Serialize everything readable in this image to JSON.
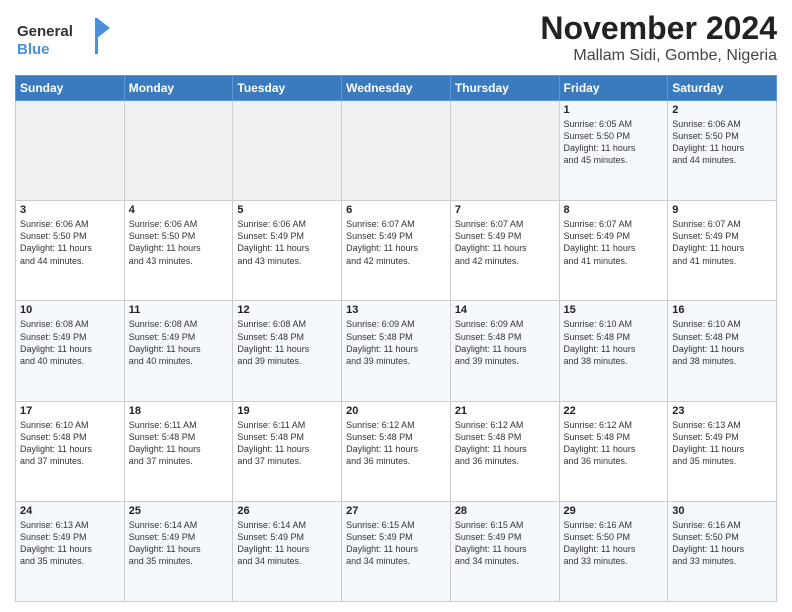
{
  "logo": {
    "line1": "General",
    "line2": "Blue"
  },
  "title": "November 2024",
  "subtitle": "Mallam Sidi, Gombe, Nigeria",
  "days_header": [
    "Sunday",
    "Monday",
    "Tuesday",
    "Wednesday",
    "Thursday",
    "Friday",
    "Saturday"
  ],
  "weeks": [
    [
      {
        "day": "",
        "info": ""
      },
      {
        "day": "",
        "info": ""
      },
      {
        "day": "",
        "info": ""
      },
      {
        "day": "",
        "info": ""
      },
      {
        "day": "",
        "info": ""
      },
      {
        "day": "1",
        "info": "Sunrise: 6:05 AM\nSunset: 5:50 PM\nDaylight: 11 hours\nand 45 minutes."
      },
      {
        "day": "2",
        "info": "Sunrise: 6:06 AM\nSunset: 5:50 PM\nDaylight: 11 hours\nand 44 minutes."
      }
    ],
    [
      {
        "day": "3",
        "info": "Sunrise: 6:06 AM\nSunset: 5:50 PM\nDaylight: 11 hours\nand 44 minutes."
      },
      {
        "day": "4",
        "info": "Sunrise: 6:06 AM\nSunset: 5:50 PM\nDaylight: 11 hours\nand 43 minutes."
      },
      {
        "day": "5",
        "info": "Sunrise: 6:06 AM\nSunset: 5:49 PM\nDaylight: 11 hours\nand 43 minutes."
      },
      {
        "day": "6",
        "info": "Sunrise: 6:07 AM\nSunset: 5:49 PM\nDaylight: 11 hours\nand 42 minutes."
      },
      {
        "day": "7",
        "info": "Sunrise: 6:07 AM\nSunset: 5:49 PM\nDaylight: 11 hours\nand 42 minutes."
      },
      {
        "day": "8",
        "info": "Sunrise: 6:07 AM\nSunset: 5:49 PM\nDaylight: 11 hours\nand 41 minutes."
      },
      {
        "day": "9",
        "info": "Sunrise: 6:07 AM\nSunset: 5:49 PM\nDaylight: 11 hours\nand 41 minutes."
      }
    ],
    [
      {
        "day": "10",
        "info": "Sunrise: 6:08 AM\nSunset: 5:49 PM\nDaylight: 11 hours\nand 40 minutes."
      },
      {
        "day": "11",
        "info": "Sunrise: 6:08 AM\nSunset: 5:49 PM\nDaylight: 11 hours\nand 40 minutes."
      },
      {
        "day": "12",
        "info": "Sunrise: 6:08 AM\nSunset: 5:48 PM\nDaylight: 11 hours\nand 39 minutes."
      },
      {
        "day": "13",
        "info": "Sunrise: 6:09 AM\nSunset: 5:48 PM\nDaylight: 11 hours\nand 39 minutes."
      },
      {
        "day": "14",
        "info": "Sunrise: 6:09 AM\nSunset: 5:48 PM\nDaylight: 11 hours\nand 39 minutes."
      },
      {
        "day": "15",
        "info": "Sunrise: 6:10 AM\nSunset: 5:48 PM\nDaylight: 11 hours\nand 38 minutes."
      },
      {
        "day": "16",
        "info": "Sunrise: 6:10 AM\nSunset: 5:48 PM\nDaylight: 11 hours\nand 38 minutes."
      }
    ],
    [
      {
        "day": "17",
        "info": "Sunrise: 6:10 AM\nSunset: 5:48 PM\nDaylight: 11 hours\nand 37 minutes."
      },
      {
        "day": "18",
        "info": "Sunrise: 6:11 AM\nSunset: 5:48 PM\nDaylight: 11 hours\nand 37 minutes."
      },
      {
        "day": "19",
        "info": "Sunrise: 6:11 AM\nSunset: 5:48 PM\nDaylight: 11 hours\nand 37 minutes."
      },
      {
        "day": "20",
        "info": "Sunrise: 6:12 AM\nSunset: 5:48 PM\nDaylight: 11 hours\nand 36 minutes."
      },
      {
        "day": "21",
        "info": "Sunrise: 6:12 AM\nSunset: 5:48 PM\nDaylight: 11 hours\nand 36 minutes."
      },
      {
        "day": "22",
        "info": "Sunrise: 6:12 AM\nSunset: 5:48 PM\nDaylight: 11 hours\nand 36 minutes."
      },
      {
        "day": "23",
        "info": "Sunrise: 6:13 AM\nSunset: 5:49 PM\nDaylight: 11 hours\nand 35 minutes."
      }
    ],
    [
      {
        "day": "24",
        "info": "Sunrise: 6:13 AM\nSunset: 5:49 PM\nDaylight: 11 hours\nand 35 minutes."
      },
      {
        "day": "25",
        "info": "Sunrise: 6:14 AM\nSunset: 5:49 PM\nDaylight: 11 hours\nand 35 minutes."
      },
      {
        "day": "26",
        "info": "Sunrise: 6:14 AM\nSunset: 5:49 PM\nDaylight: 11 hours\nand 34 minutes."
      },
      {
        "day": "27",
        "info": "Sunrise: 6:15 AM\nSunset: 5:49 PM\nDaylight: 11 hours\nand 34 minutes."
      },
      {
        "day": "28",
        "info": "Sunrise: 6:15 AM\nSunset: 5:49 PM\nDaylight: 11 hours\nand 34 minutes."
      },
      {
        "day": "29",
        "info": "Sunrise: 6:16 AM\nSunset: 5:50 PM\nDaylight: 11 hours\nand 33 minutes."
      },
      {
        "day": "30",
        "info": "Sunrise: 6:16 AM\nSunset: 5:50 PM\nDaylight: 11 hours\nand 33 minutes."
      }
    ]
  ]
}
